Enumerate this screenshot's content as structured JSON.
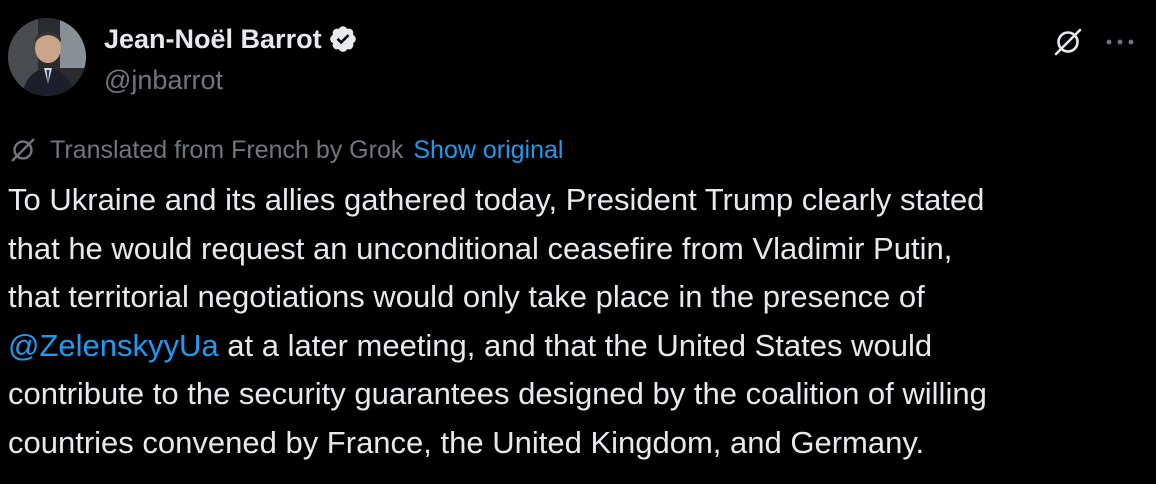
{
  "colors": {
    "background": "#000000",
    "text_primary": "#e7e9ea",
    "text_secondary": "#71767b",
    "link": "#1d9bf0"
  },
  "author": {
    "name": "Jean-Noël Barrot",
    "handle": "@jnbarrot",
    "avatar_icon": "profile-photo",
    "verified_icon": "verified-badge-icon"
  },
  "actions": {
    "grok_icon": "grok-icon",
    "more_icon": "more-dots-icon",
    "more_label": "···"
  },
  "translation": {
    "icon": "grok-icon",
    "note": "Translated from French by Grok",
    "show_original": "Show original"
  },
  "post": {
    "lines": {
      "l1": "To Ukraine and its allies gathered today, President Trump clearly stated",
      "l2": "that he would request an unconditional ceasefire from Vladimir Putin,",
      "l3": "that territorial negotiations would only take place in the presence of",
      "l4_mention": "@ZelenskyyUa",
      "l4_rest": " at a later meeting, and that the United States would",
      "l5": "contribute to the security guarantees designed by the coalition of willing",
      "l6": "countries convened by France, the United Kingdom, and Germany."
    }
  }
}
